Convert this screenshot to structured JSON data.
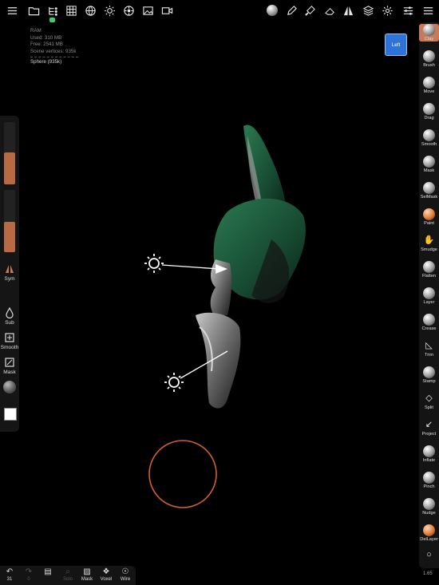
{
  "stats": {
    "ram_label": "RAM",
    "used": "Used: 310 MB",
    "free": "Free: 2541 MB",
    "scene_vertices": "Scene vertices: 935k",
    "object": "Sphere (935k)"
  },
  "view": {
    "label": "Left"
  },
  "left_panel": {
    "sym_label": "Sym",
    "sub_label": "Sub",
    "smooth_label": "Smooth",
    "mask_label": "Mask"
  },
  "tools": [
    {
      "label": "Clay",
      "icon": "clay-icon",
      "active": true
    },
    {
      "label": "Brush",
      "icon": "brush-icon"
    },
    {
      "label": "Move",
      "icon": "move-icon"
    },
    {
      "label": "Drag",
      "icon": "drag-icon"
    },
    {
      "label": "Smooth",
      "icon": "smooth-icon"
    },
    {
      "label": "Mask",
      "icon": "mask-icon"
    },
    {
      "label": "SelMask",
      "icon": "selmask-icon"
    },
    {
      "label": "Paint",
      "icon": "paint-icon"
    },
    {
      "label": "Smudge",
      "icon": "smudge-icon"
    },
    {
      "label": "Flatten",
      "icon": "flatten-icon"
    },
    {
      "label": "Layer",
      "icon": "layer-icon"
    },
    {
      "label": "Crease",
      "icon": "crease-icon"
    },
    {
      "label": "Trim",
      "icon": "trim-icon"
    },
    {
      "label": "Stamp",
      "icon": "stamp-icon"
    },
    {
      "label": "Split",
      "icon": "split-icon"
    },
    {
      "label": "Project",
      "icon": "project-icon"
    },
    {
      "label": "Inflate",
      "icon": "inflate-icon"
    },
    {
      "label": "Pinch",
      "icon": "pinch-icon"
    },
    {
      "label": "Nudge",
      "icon": "nudge-icon"
    },
    {
      "label": "DelLayer",
      "icon": "dellayer-icon"
    }
  ],
  "version": "1.65",
  "bottom": {
    "undo_count": "31",
    "redo_count": "0",
    "solo_label": "Solo",
    "mask_label": "Mask",
    "voxel_label": "Voxel",
    "wire_label": "Wire"
  },
  "colors": {
    "accent_orange": "#c77a55",
    "view_blue": "#2e74d8",
    "model_green": "#1f5a3a",
    "brush_ring": "#d0612a"
  }
}
